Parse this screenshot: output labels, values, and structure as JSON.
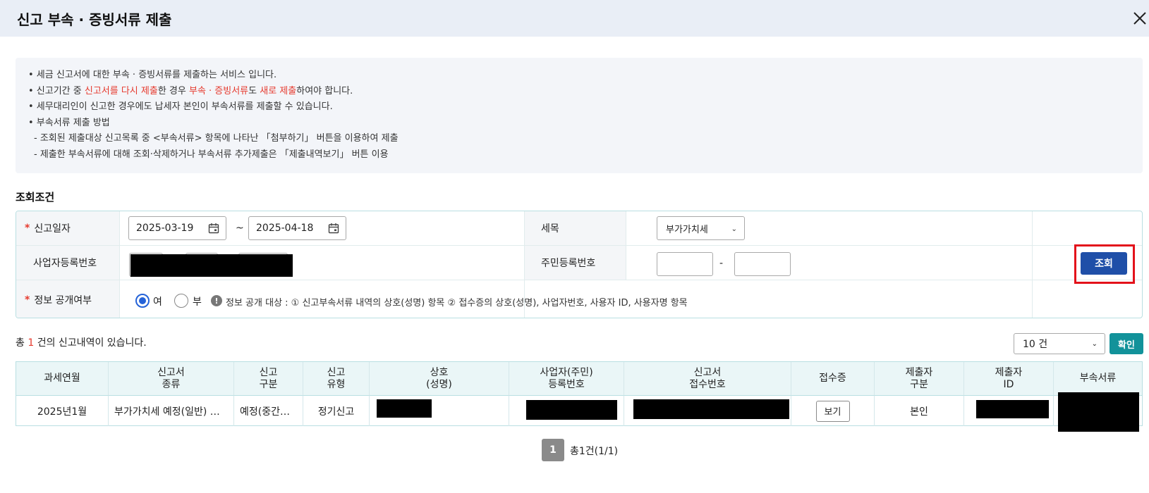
{
  "dialog": {
    "title": "신고 부속 · 증빙서류 제출"
  },
  "notice": {
    "line1": "• 세금 신고서에 대한 부속 · 증빙서류를 제출하는 서비스 입니다.",
    "line2_a": "• 신고기간 중 ",
    "line2_b": "신고서를 다시 제출",
    "line2_c": "한 경우 ",
    "line2_d": "부속 · 증빙서류",
    "line2_e": "도 ",
    "line2_f": "새로 제출",
    "line2_g": "하여야 합니다.",
    "line3": "• 세무대리인이 신고한 경우에도 납세자 본인이 부속서류를 제출할 수 있습니다.",
    "line4": "• 부속서류 제출 방법",
    "line5": "- 조회된 제출대상 신고목록 중 <부속서류> 항목에 나타난 「첨부하기」 버튼을 이용하여 제출",
    "line6": "- 제출한 부속서류에 대해 조회·삭제하거나 부속서류 추가제출은 「제출내역보기」 버튼 이용"
  },
  "conditions": {
    "title": "조회조건",
    "report_date_label": "신고일자",
    "date_from": "2025-03-19",
    "date_tilde": "~",
    "date_to": "2025-04-18",
    "tax_item_label": "세목",
    "tax_item_value": "부가가치세",
    "biz_no_label": "사업자등록번호",
    "resident_no_label": "주민등록번호",
    "resident_dash": "-",
    "disclose_label": "정보 공개여부",
    "disclose_yes": "여",
    "disclose_no": "부",
    "disclose_selected": "yes",
    "disclose_info": "정보 공개 대상 : ① 신고부속서류 내역의 상호(성명) 항목 ② 접수증의 상호(성명), 사업자번호, 사용자 ID, 사용자명 항목",
    "search_button": "조회"
  },
  "result": {
    "total_prefix": "총 ",
    "total_count": "1",
    "total_suffix": " 건의 신고내역이 있습니다.",
    "page_size": "10 건",
    "confirm_button": "확인"
  },
  "table": {
    "headers": [
      "과세연월",
      "신고서\n종류",
      "신고\n구분",
      "신고\n유형",
      "상호\n(성명)",
      "사업자(주민)\n등록번호",
      "신고서\n접수번호",
      "접수증",
      "제출자\n구분",
      "제출자\nID",
      "부속서류"
    ],
    "rows": [
      {
        "period": "2025년1월",
        "report_type": "부가가치세 예정(일반) …",
        "report_div": "예정(중간…",
        "report_kind": "정기신고",
        "receipt_button": "보기",
        "submitter_div": "본인"
      }
    ]
  },
  "pagination": {
    "current": "1",
    "info": "총1건(1/1)"
  },
  "colors": {
    "accent_blue": "#1f4fa8",
    "teal": "#12929a",
    "red": "#e63a2e",
    "highlight": "#e3121b"
  }
}
